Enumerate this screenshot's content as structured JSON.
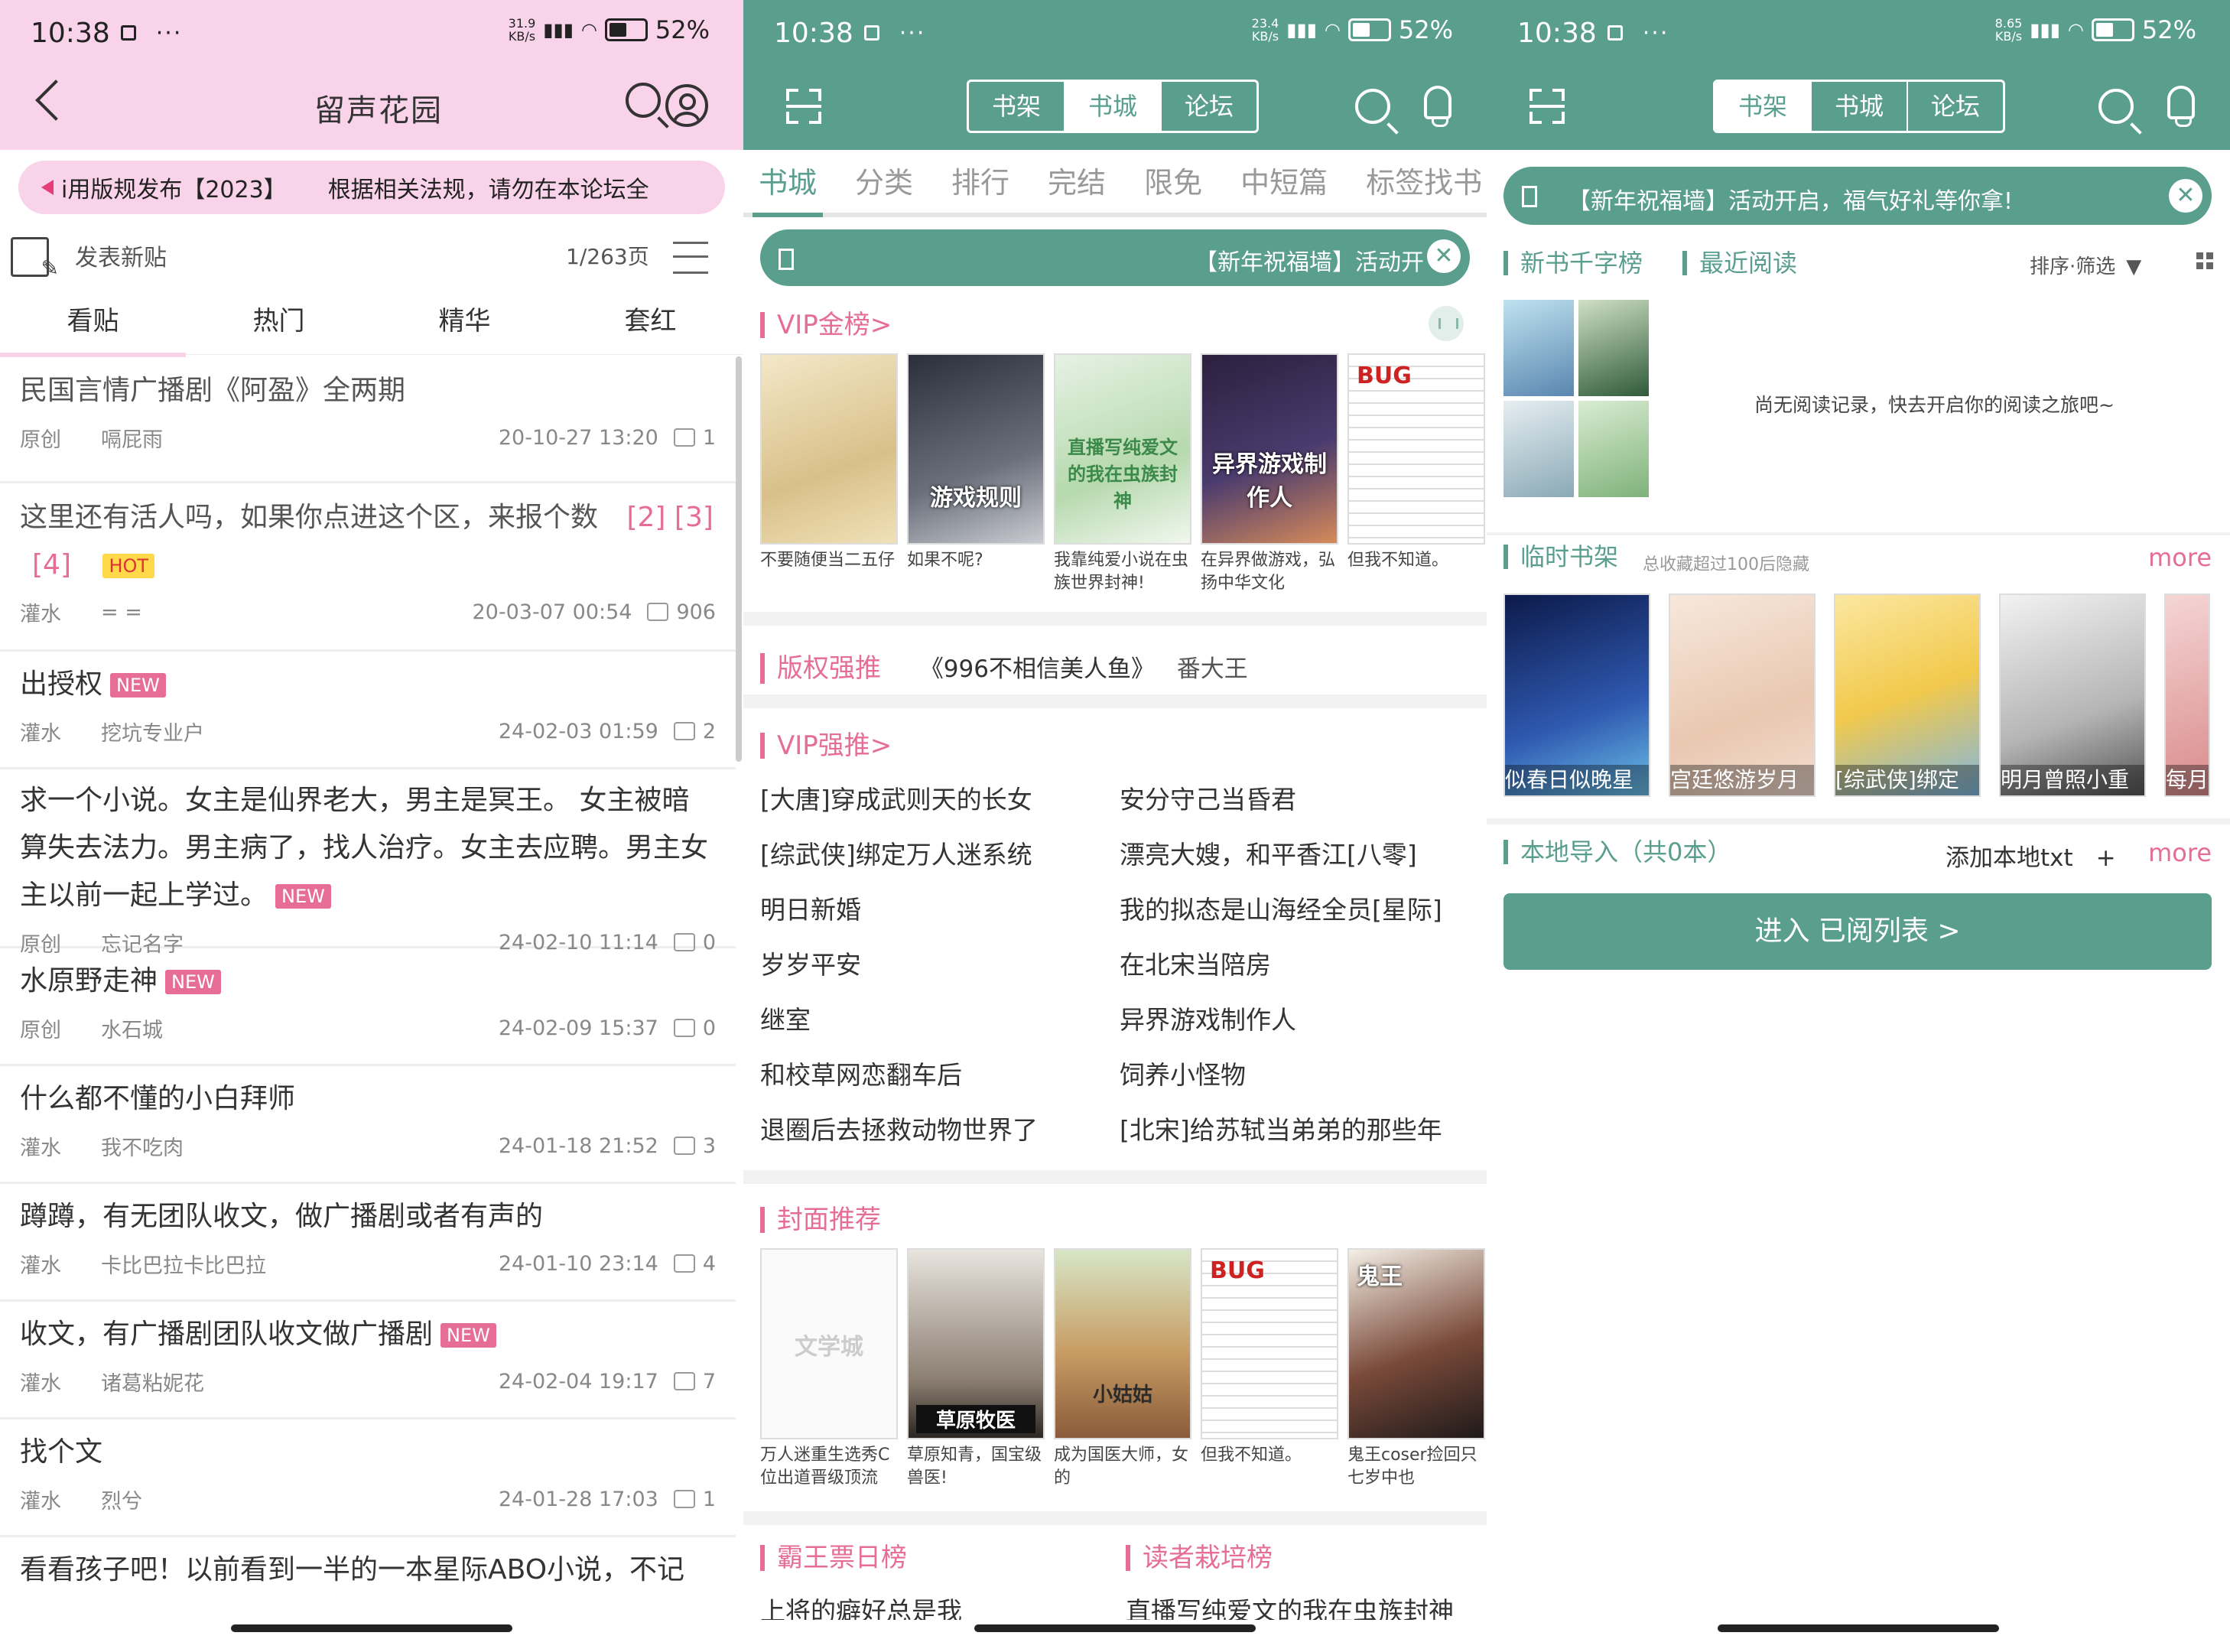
{
  "colors": {
    "pink_header": "#f8d3e9",
    "pink_accent": "#e66d95",
    "teal": "#5a9e8e",
    "hot_yellow": "#ffd94a"
  },
  "p1": {
    "status": {
      "time": "10:38",
      "speed": "31.9\nKB/s",
      "battery": "52%"
    },
    "title": "留声花园",
    "notice_title": "i用版规发布【2023】",
    "notice_text": "根据相关法规，请勿在本论坛全",
    "post_label": "发表新贴",
    "page": "1/263页",
    "tabs": [
      "看贴",
      "热门",
      "精华",
      "套红"
    ],
    "posts": [
      {
        "title": "民国言情广播剧《阿盈》全两期",
        "cat": "原创",
        "author": "嗝屁雨",
        "time": "20-10-27 13:20",
        "comments": "1"
      },
      {
        "title": "这里还有活人吗，如果你点进这个区，来报个数",
        "pages": [
          "[2]",
          "[3]",
          "[4]"
        ],
        "tag": "HOT",
        "cat": "灌水",
        "author": "= =",
        "time": "20-03-07 00:54",
        "comments": "906"
      },
      {
        "title": "出授权",
        "tag": "NEW",
        "cat": "灌水",
        "author": "挖坑专业户",
        "time": "24-02-03 01:59",
        "comments": "2"
      },
      {
        "title": "求一个小说。女主是仙界老大，男主是冥王。 女主被暗算失去法力。男主病了，找人治疗。女主去应聘。男主女主以前一起上学过。",
        "tag": "NEW",
        "cat": "原创",
        "author": "忘记名字",
        "time": "24-02-10 11:14",
        "comments": "0"
      },
      {
        "title": "水原野走神",
        "tag": "NEW",
        "cat": "原创",
        "author": "水石城",
        "time": "24-02-09 15:37",
        "comments": "0"
      },
      {
        "title": "什么都不懂的小白拜师",
        "cat": "灌水",
        "author": "我不吃肉",
        "time": "24-01-18 21:52",
        "comments": "3"
      },
      {
        "title": "蹲蹲，有无团队收文，做广播剧或者有声的",
        "cat": "灌水",
        "author": "卡比巴拉卡比巴拉",
        "time": "24-01-10 23:14",
        "comments": "4"
      },
      {
        "title": "收文，有广播剧团队收文做广播剧",
        "tag": "NEW",
        "cat": "灌水",
        "author": "诸葛粘妮花",
        "time": "24-02-04 19:17",
        "comments": "7"
      },
      {
        "title": "找个文",
        "cat": "灌水",
        "author": "烈兮",
        "time": "24-01-28 17:03",
        "comments": "1"
      },
      {
        "title": "看看孩子吧！以前看到一半的一本星际ABO小说，不记"
      }
    ]
  },
  "p2": {
    "status": {
      "time": "10:38",
      "speed": "23.4\nKB/s",
      "battery": "52%"
    },
    "seg": [
      "书架",
      "书城",
      "论坛"
    ],
    "subtabs": [
      "书城",
      "分类",
      "排行",
      "完结",
      "限免",
      "中短篇",
      "标签找书"
    ],
    "notice": "【新年祝福墙】活动开",
    "vip_gold": {
      "title": "VIP金榜>",
      "books": [
        {
          "cap": "不要随便当二五仔",
          "cover_text": ""
        },
        {
          "cap": "如果不呢?",
          "cover_text": "游戏规则"
        },
        {
          "cap": "我靠纯爱小说在虫族世界封神!",
          "cover_text": "直播写纯爱文的我在虫族封神"
        },
        {
          "cap": "在异界做游戏，弘扬中华文化",
          "cover_text": "异界游戏制作人"
        },
        {
          "cap": "但我不知道。",
          "cover_text": "BUG"
        }
      ]
    },
    "copyright": {
      "label": "版权强推",
      "book": "《996不相信美人鱼》",
      "author": "番大王"
    },
    "vip_strong": {
      "title": "VIP强推>",
      "left": [
        "[大唐]穿成武则天的长女",
        "[综武侠]绑定万人迷系统",
        "明日新婚",
        "岁岁平安",
        "继室",
        "和校草网恋翻车后",
        "退圈后去拯救动物世界了"
      ],
      "right": [
        "安分守己当昏君",
        "漂亮大嫂，和平香江[八零]",
        "我的拟态是山海经全员[星际]",
        "在北宋当陪房",
        "异界游戏制作人",
        "饲养小怪物",
        "[北宋]给苏轼当弟弟的那些年"
      ]
    },
    "cover_rec": {
      "title": "封面推荐",
      "books": [
        {
          "cap": "万人迷重生选秀C位出道晋级顶流",
          "cover_text": "文学城"
        },
        {
          "cap": "草原知青，国宝级兽医!",
          "cover_text": "草原牧医"
        },
        {
          "cap": "成为国医大师，女的",
          "cover_text": "小姑姑"
        },
        {
          "cap": "但我不知道。",
          "cover_text": "BUG"
        },
        {
          "cap": "鬼王coser捡回只七岁中也",
          "cover_text": "鬼王"
        }
      ]
    },
    "bottom_left": {
      "title": "霸王票日榜",
      "item": "上将的癖好总是我"
    },
    "bottom_right": {
      "title": "读者栽培榜",
      "item": "直播写纯爱文的我在虫族封神"
    }
  },
  "p3": {
    "status": {
      "time": "10:38",
      "speed": "8.65\nKB/s",
      "battery": "52%"
    },
    "seg": [
      "书架",
      "书城",
      "论坛"
    ],
    "notice": "【新年祝福墙】活动开启，福气好礼等你拿!",
    "tab_new": "新书千字榜",
    "tab_recent": "最近阅读",
    "sort": "排序·筛选",
    "empty": "尚无阅读记录，快去开启你的阅读之旅吧~",
    "temp_shelf": "临时书架",
    "temp_note": "总收藏超过100后隐藏",
    "more": "more",
    "shelf_books": [
      "似春日似晚星",
      "宫廷悠游岁月",
      "[综武侠]绑定",
      "明月曾照小重",
      "每月"
    ],
    "local": "本地导入（共0本）",
    "add_local": "添加本地txt",
    "plus": "+",
    "enter": "进入 已阅列表 >"
  }
}
